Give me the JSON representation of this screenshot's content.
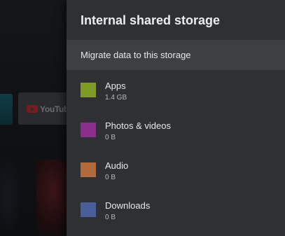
{
  "panel": {
    "title": "Internal shared storage",
    "migrate_label": "Migrate data to this storage",
    "items": [
      {
        "label": "Apps",
        "size": "1.4 GB",
        "color": "#7f9b26"
      },
      {
        "label": "Photos & videos",
        "size": "0 B",
        "color": "#8a2e8e"
      },
      {
        "label": "Audio",
        "size": "0 B",
        "color": "#b06a3c"
      },
      {
        "label": "Downloads",
        "size": "0 B",
        "color": "#4a5e9c"
      }
    ]
  },
  "background": {
    "youtube_text": "YouTube"
  }
}
